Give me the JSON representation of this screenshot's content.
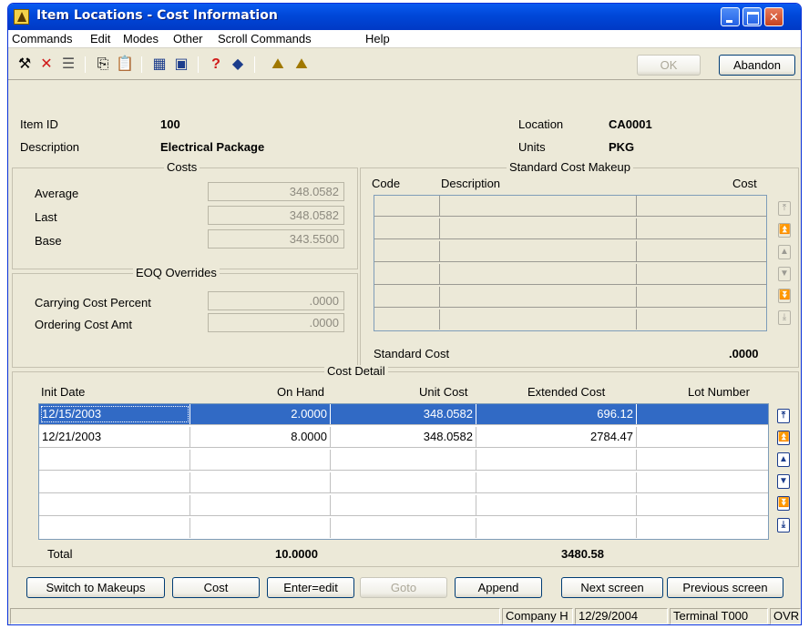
{
  "window": {
    "title": "Item Locations  - Cost Information"
  },
  "menu": [
    "Commands",
    "Edit",
    "Modes",
    "Other",
    "Scroll Commands",
    "Help"
  ],
  "toolbar": {
    "ok_label": "OK",
    "abandon_label": "Abandon"
  },
  "header": {
    "item_id_label": "Item ID",
    "item_id": "100",
    "description_label": "Description",
    "description": "Electrical Package",
    "location_label": "Location",
    "location": "CA0001",
    "units_label": "Units",
    "units": "PKG"
  },
  "costs": {
    "title": "Costs",
    "average_label": "Average",
    "average": "348.0582",
    "last_label": "Last",
    "last": "348.0582",
    "base_label": "Base",
    "base": "343.5500"
  },
  "eoq": {
    "title": "EOQ Overrides",
    "carrying_label": "Carrying Cost Percent",
    "carrying": ".0000",
    "ordering_label": "Ordering Cost Amt",
    "ordering": ".0000"
  },
  "std_makeup": {
    "title": "Standard Cost Makeup",
    "col_code": "Code",
    "col_description": "Description",
    "col_cost": "Cost",
    "standard_cost_label": "Standard Cost",
    "standard_cost": ".0000"
  },
  "cost_detail": {
    "title": "Cost Detail",
    "columns": [
      "Init Date",
      "On Hand",
      "Unit Cost",
      "Extended Cost",
      "Lot Number"
    ],
    "rows": [
      {
        "date": "12/15/2003",
        "on_hand": "2.0000",
        "unit_cost": "348.0582",
        "extended": "696.12",
        "lot": ""
      },
      {
        "date": "12/21/2003",
        "on_hand": "8.0000",
        "unit_cost": "348.0582",
        "extended": "2784.47",
        "lot": ""
      }
    ],
    "total_label": "Total",
    "total_on_hand": "10.0000",
    "total_extended": "3480.58"
  },
  "buttons": {
    "switch": "Switch to Makeups",
    "cost": "Cost",
    "enter_edit": "Enter=edit",
    "goto": "Goto",
    "append": "Append",
    "next": "Next screen",
    "previous": "Previous screen"
  },
  "status": {
    "company": "Company H",
    "date": "12/29/2004",
    "terminal": "Terminal T000",
    "mode": "OVR"
  }
}
